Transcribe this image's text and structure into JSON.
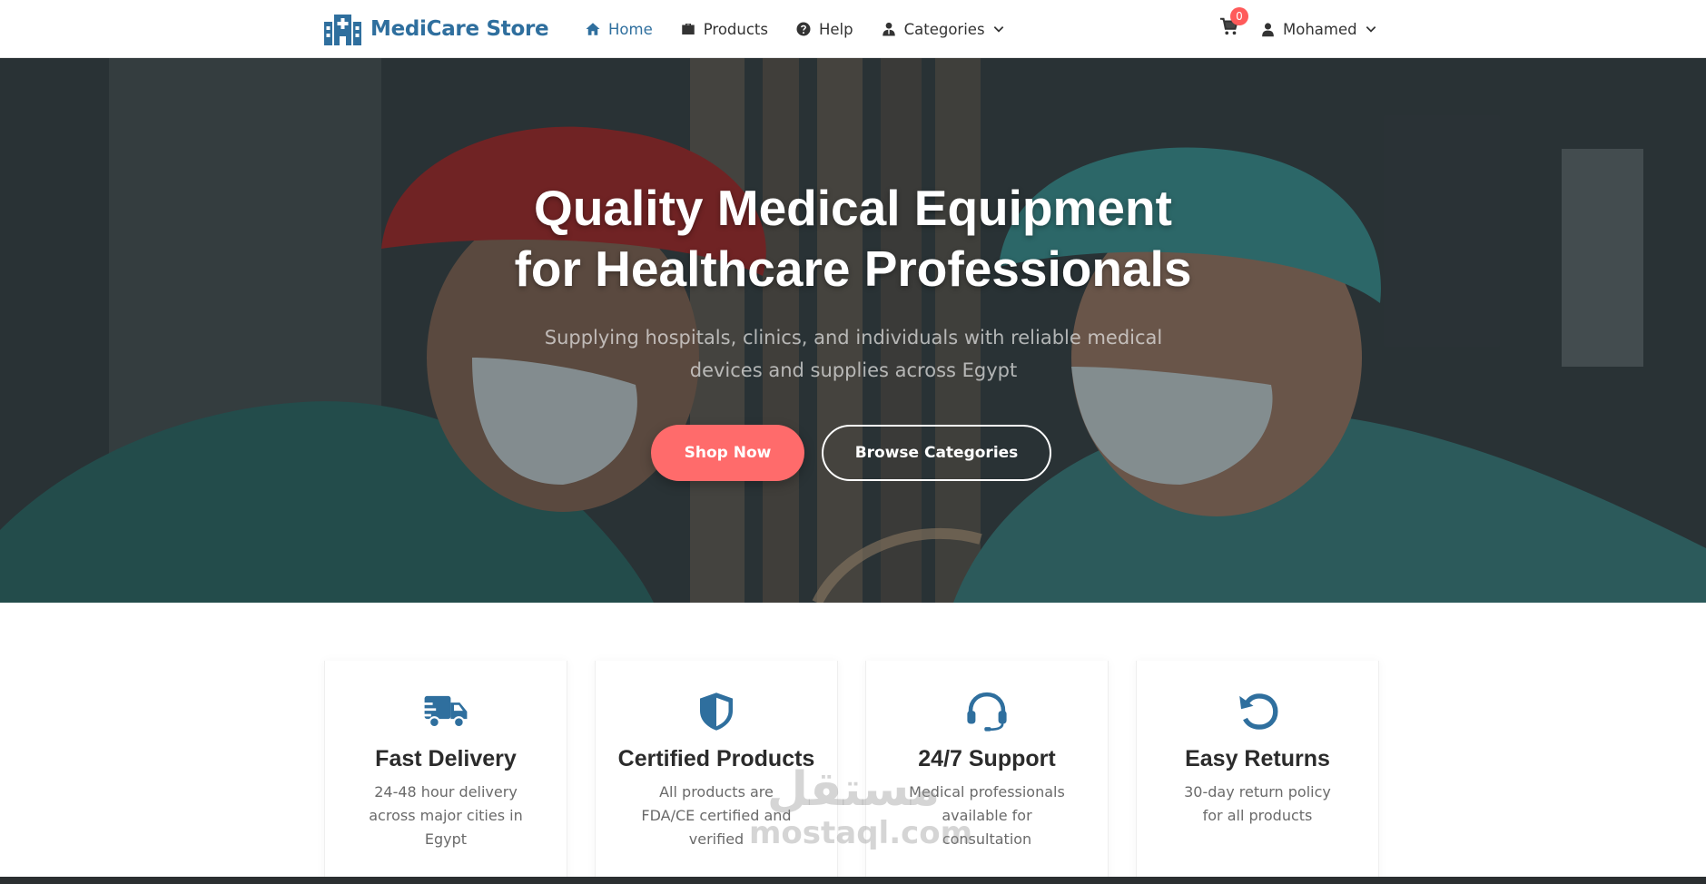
{
  "brand": {
    "name": "MediCare Store",
    "color": "#2f6f9e"
  },
  "nav": {
    "items": [
      {
        "label": "Home",
        "icon": "home-icon",
        "active": true
      },
      {
        "label": "Products",
        "icon": "briefcase-icon",
        "active": false
      },
      {
        "label": "Help",
        "icon": "question-circle-icon",
        "active": false
      },
      {
        "label": "Categories",
        "icon": "user-tie-icon",
        "active": false,
        "dropdown": true
      }
    ],
    "cart": {
      "count": "0",
      "icon": "cart-icon"
    },
    "user": {
      "name": "Mohamed",
      "icon": "user-icon"
    }
  },
  "hero": {
    "title_line1": "Quality Medical Equipment",
    "title_line2": "for Healthcare Professionals",
    "subtitle": "Supplying hospitals, clinics, and individuals with reliable medical devices and supplies across Egypt",
    "primary_button": "Shop Now",
    "secondary_button": "Browse Categories",
    "accent_color": "#ff6b6b"
  },
  "features": [
    {
      "title": "Fast Delivery",
      "description": "24-48 hour delivery across major cities in Egypt",
      "icon": "truck-icon"
    },
    {
      "title": "Certified Products",
      "description": "All products are FDA/CE certified and verified",
      "icon": "shield-icon"
    },
    {
      "title": "24/7 Support",
      "description": "Medical professionals available for consultation",
      "icon": "headset-icon"
    },
    {
      "title": "Easy Returns",
      "description": "30-day return policy for all products",
      "icon": "undo-icon"
    }
  ],
  "watermark": {
    "arabic": "مستقل",
    "latin": "mostaql.com"
  }
}
